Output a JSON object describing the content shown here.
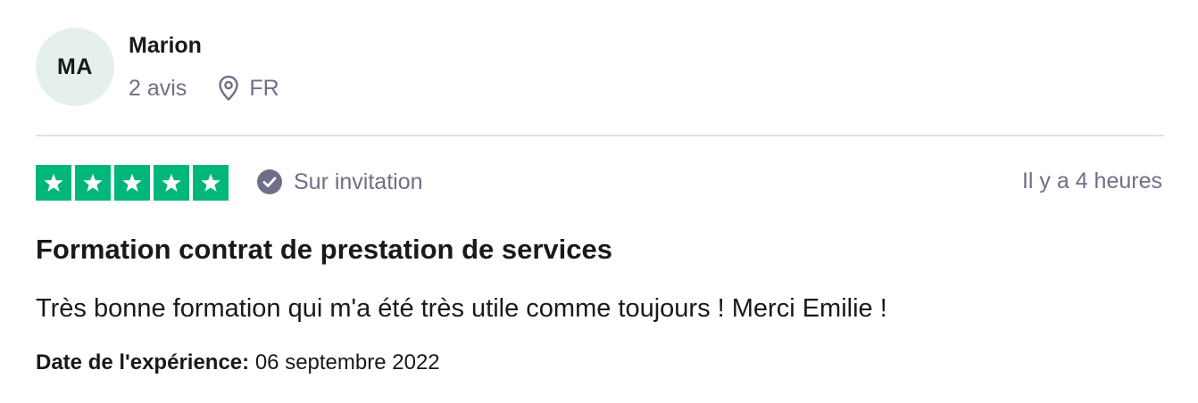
{
  "reviewer": {
    "initials": "MA",
    "name": "Marion",
    "reviews_count": "2 avis",
    "location_icon": "location-pin-icon",
    "country": "FR"
  },
  "review": {
    "rating": 5,
    "star_color": "#00b67a",
    "verification_icon": "check-circle-icon",
    "verification_label": "Sur invitation",
    "posted_ago": "Il y a 4 heures",
    "title": "Formation contrat de prestation de services",
    "text": "Très bonne formation qui m'a été très utile comme toujours ! Merci Emilie !",
    "experience_label": "Date de l'expérience:",
    "experience_date": "06 septembre 2022"
  }
}
